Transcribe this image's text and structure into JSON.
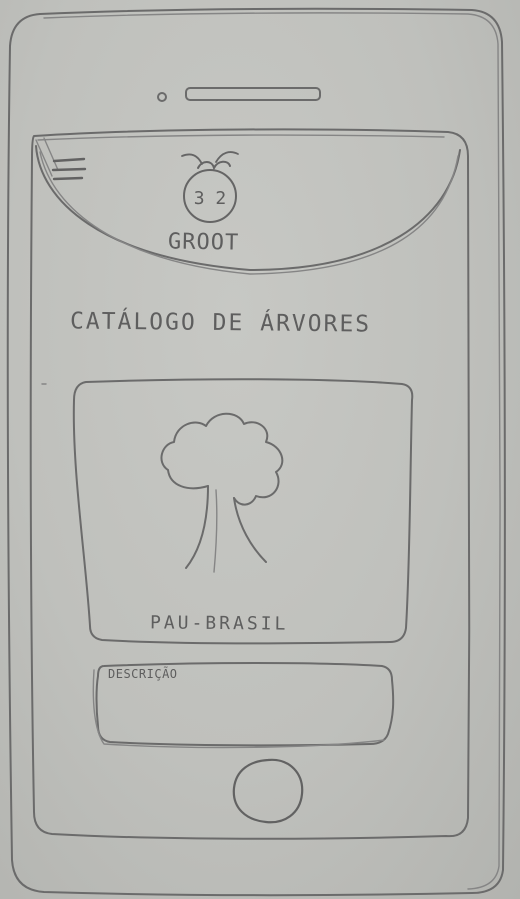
{
  "header": {
    "logo_text": "GROOT",
    "logo_icon": "fruit-face-icon",
    "logo_glyph": "3 2",
    "menu_icon": "hamburger-menu-icon"
  },
  "main": {
    "title": "CATÁLOGO DE ÁRVORES",
    "card": {
      "image_icon": "tree-icon",
      "name": "PAU-BRASIL"
    },
    "description": {
      "label": "DESCRIÇÃO"
    }
  },
  "device": {
    "home_button_icon": "home-button-icon"
  }
}
